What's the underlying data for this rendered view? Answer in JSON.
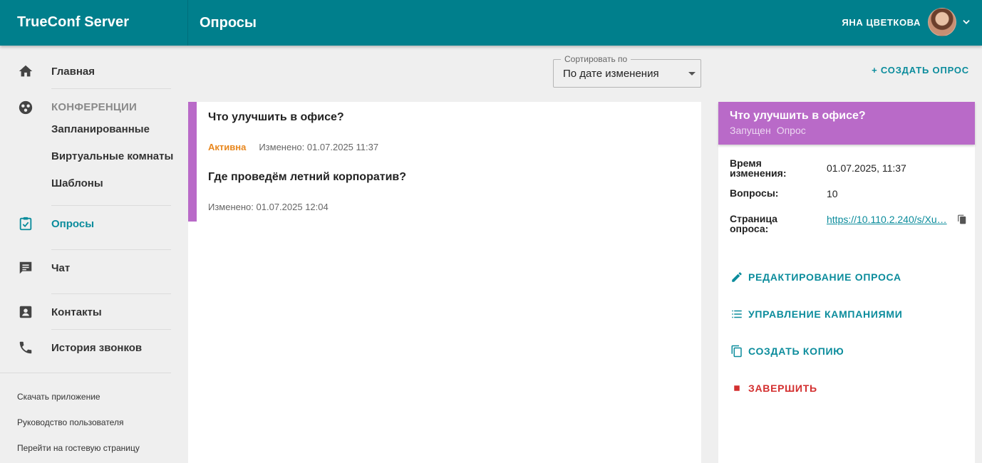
{
  "app": {
    "brand": "TrueConf Server",
    "page_title": "Опросы"
  },
  "user": {
    "name": "ЯНА ЦВЕТКОВА"
  },
  "colors": {
    "header": "#007f8c",
    "accent": "#0b8c9c",
    "poll_accent": "#b96ac8",
    "active_status": "#e8871e",
    "danger": "#d32f2f"
  },
  "sidebar": {
    "home": "Главная",
    "conferences": {
      "label": "КОНФЕРЕНЦИИ",
      "items": [
        "Запланированные",
        "Виртуальные комнаты",
        "Шаблоны"
      ]
    },
    "polls": "Опросы",
    "chat": "Чат",
    "contacts": "Контакты",
    "call_history": "История звонков",
    "footer_links": [
      "Скачать приложение",
      "Руководство пользователя",
      "Перейти на гостевую страницу"
    ]
  },
  "toolbar": {
    "sort_label": "Сортировать по",
    "sort_value": "По дате изменения",
    "create_button": "+ СОЗДАТЬ ОПРОС"
  },
  "polls": [
    {
      "title": "Что улучшить в офисе?",
      "status": "Активна",
      "modified": "Изменено: 01.07.2025 11:37"
    },
    {
      "title": "Где проведём летний корпоратив?",
      "status": "",
      "modified": "Изменено: 01.07.2025 12:04"
    }
  ],
  "detail": {
    "title": "Что улучшить в офисе?",
    "state": "Запущен",
    "kind": "Опрос",
    "props": {
      "modified_key": "Время изменения:",
      "modified_val": "01.07.2025, 11:37",
      "questions_key": "Вопросы:",
      "questions_val": "10",
      "page_key": "Страница опроса:",
      "page_val": "https://10.110.2.240/s/Xu…"
    },
    "actions": {
      "edit": "РЕДАКТИРОВАНИЕ ОПРОСА",
      "campaigns": "УПРАВЛЕНИЕ КАМПАНИЯМИ",
      "copy": "СОЗДАТЬ КОПИЮ",
      "finish": "ЗАВЕРШИТЬ"
    }
  },
  "icons": [
    "home-icon",
    "conference-icon",
    "poll-icon",
    "chat-icon",
    "contacts-icon",
    "phone-icon",
    "chevron-down-icon",
    "copy-icon",
    "edit-icon",
    "list-icon",
    "duplicate-icon",
    "stop-icon"
  ]
}
